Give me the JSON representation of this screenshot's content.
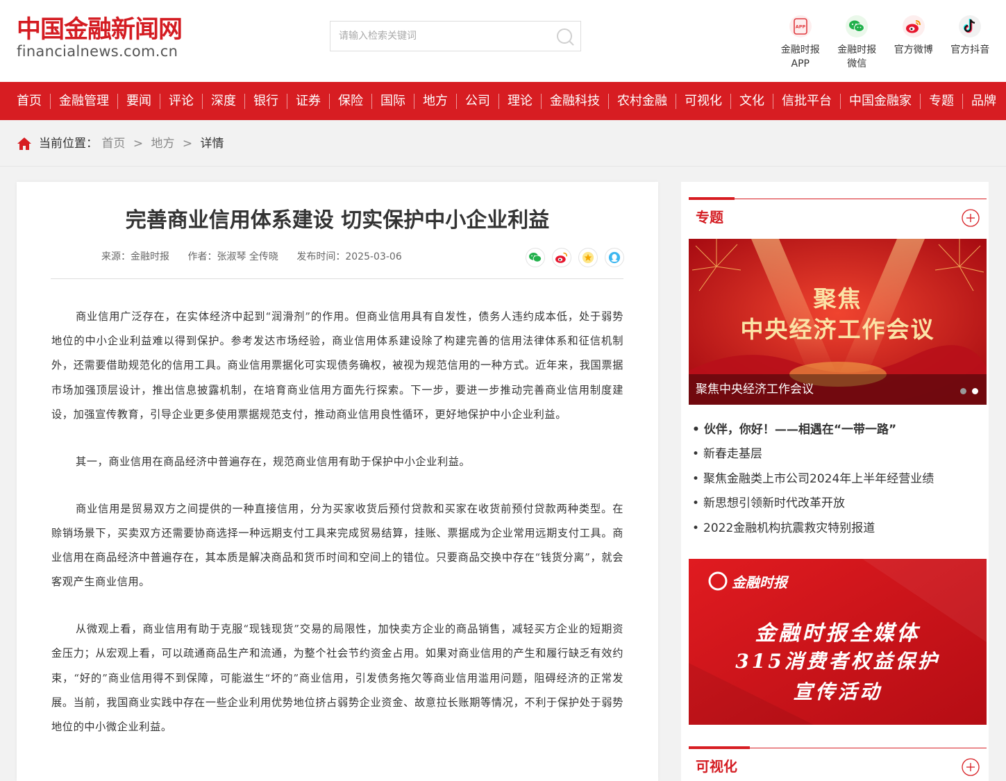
{
  "header": {
    "logo_cn": "中国金融新闻网",
    "logo_en": "financialnews.com.cn",
    "search_placeholder": "请输入检索关键词",
    "shortcuts": [
      {
        "label_line1": "金融时报",
        "label_line2": "APP",
        "icon": "app-icon"
      },
      {
        "label_line1": "金融时报",
        "label_line2": "微信",
        "icon": "wechat-icon"
      },
      {
        "label_line1": "官方微博",
        "label_line2": "",
        "icon": "weibo-icon"
      },
      {
        "label_line1": "官方抖音",
        "label_line2": "",
        "icon": "douyin-icon"
      }
    ],
    "app_badge": "APP"
  },
  "nav": {
    "items": [
      "首页",
      "金融管理",
      "要闻",
      "评论",
      "深度",
      "银行",
      "证券",
      "保险",
      "国际",
      "地方",
      "公司",
      "理论",
      "金融科技",
      "农村金融",
      "可视化",
      "文化",
      "信批平台",
      "中国金融家",
      "专题",
      "品牌"
    ]
  },
  "breadcrumb": {
    "prefix": "当前位置：",
    "home": "首页",
    "section": "地方",
    "current": "详情",
    "sep": ">"
  },
  "article": {
    "title": "完善商业信用体系建设 切实保护中小企业利益",
    "source": "来源：金融时报",
    "author": "作者：张淑琴 全传晓",
    "date": "发布时间：2025-03-06",
    "paragraphs": [
      "商业信用广泛存在，在实体经济中起到“润滑剂”的作用。但商业信用具有自发性，债务人违约成本低，处于弱势地位的中小企业利益难以得到保护。参考发达市场经验，商业信用体系建设除了构建完善的信用法律体系和征信机制外，还需要借助规范化的信用工具。商业信用票据化可实现债务确权，被视为规范信用的一种方式。近年来，我国票据市场加强顶层设计，推出信息披露机制，在培育商业信用方面先行探索。下一步，要进一步推动完善商业信用制度建设，加强宣传教育，引导企业更多使用票据规范支付，推动商业信用良性循环，更好地保护中小企业利益。",
      "其一，商业信用在商品经济中普遍存在，规范商业信用有助于保护中小企业利益。",
      "商业信用是贸易双方之间提供的一种直接信用，分为买家收货后预付贷款和买家在收货前预付贷款两种类型。在赊销场景下，买卖双方还需要协商选择一种远期支付工具来完成贸易结算，挂账、票据成为企业常用远期支付工具。商业信用在商品经济中普遍存在，其本质是解决商品和货币时间和空间上的错位。只要商品交换中存在“钱货分离”，就会客观产生商业信用。",
      "从微观上看，商业信用有助于克服“现钱现货”交易的局限性，加快卖方企业的商品销售，减轻买方企业的短期资金压力；从宏观上看，可以疏通商品生产和流通，为整个社会节约资金占用。如果对商业信用的产生和履行缺乏有效约束，“好的”商业信用得不到保障，可能滋生“坏的”商业信用，引发债务拖欠等商业信用滥用问题，阻碍经济的正常发展。当前，我国商业实践中存在一些企业利用优势地位挤占弱势企业资金、故意拉长账期等情况，不利于保护处于弱势地位的中小微企业利益。"
    ]
  },
  "sidebar": {
    "topic_section_title": "专题",
    "banner1": {
      "line1": "聚焦",
      "line2": "中央经济工作会议",
      "caption": "聚焦中央经济工作会议"
    },
    "topics": [
      "伙伴，你好！——相遇在“一带一路”",
      "新春走基层",
      "聚焦金融类上市公司2024年上半年经营业绩",
      "新思想引领新时代改革开放",
      "2022金融机构抗震救灾特别报道"
    ],
    "banner2": {
      "brand": "金融时报",
      "l1": "金融时报全媒体",
      "l2": "315消费者权益保护",
      "l3": "宣传活动"
    },
    "viz_section_title": "可视化"
  },
  "colors": {
    "brand_red": "#d71d22",
    "text": "#333333"
  }
}
